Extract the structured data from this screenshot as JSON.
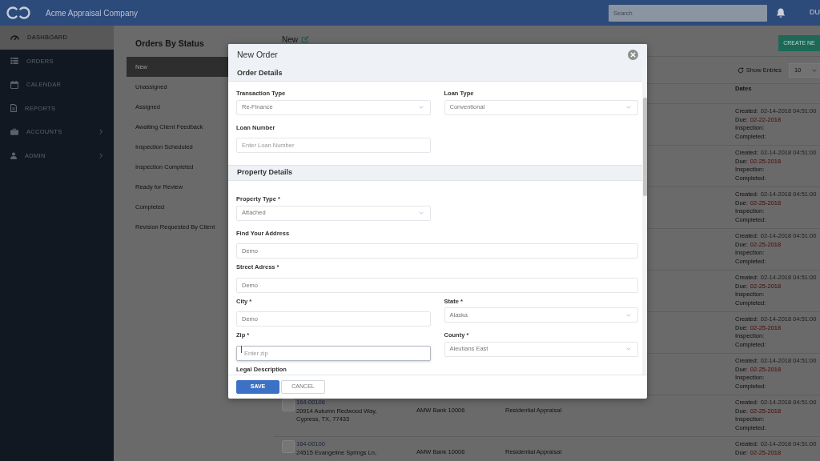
{
  "top_bar": {
    "title": "Acme Appraisal Company",
    "search": {
      "placeholder": "Search"
    },
    "user": "DU"
  },
  "sidebar": {
    "items": [
      {
        "label": "DASHBOARD",
        "selected": true,
        "expandable": false
      },
      {
        "label": "ORDERS",
        "selected": false,
        "expandable": false
      },
      {
        "label": "CALENDAR",
        "selected": false,
        "expandable": false
      },
      {
        "label": "REPORTS",
        "selected": false,
        "expandable": false
      },
      {
        "label": "ACCOUNTS",
        "selected": false,
        "expandable": true
      },
      {
        "label": "ADMIN",
        "selected": false,
        "expandable": true
      }
    ]
  },
  "orders_by_status": {
    "title": "Orders By Status",
    "items": [
      {
        "label": "New",
        "selected": true
      },
      {
        "label": "Unassigned",
        "selected": false
      },
      {
        "label": "Assigned",
        "selected": false
      },
      {
        "label": "Awaiting Client Feedback",
        "selected": false
      },
      {
        "label": "Inspection Scheduled",
        "selected": false
      },
      {
        "label": "Inspection Completed",
        "selected": false
      },
      {
        "label": "Ready for Review",
        "selected": false
      },
      {
        "label": "Completed",
        "selected": false
      },
      {
        "label": "Revision Requested By Client",
        "selected": false
      }
    ]
  },
  "orders": {
    "heading": "New",
    "create_button": "CREATE NE",
    "show_entries": {
      "label": "Show Entries",
      "value": "10"
    },
    "dates_header": "Dates",
    "rows": [
      {
        "dates": [
          {
            "kind": "created",
            "label": "Created:",
            "value": "02-14-2018 04:51:00"
          },
          {
            "kind": "due",
            "label": "Due:",
            "value": "02-22-2018"
          },
          {
            "label": "Inspection:"
          },
          {
            "label": "Completed:"
          }
        ]
      },
      {
        "dates": [
          {
            "kind": "created",
            "label": "Created:",
            "value": "02-14-2018 04:51:00"
          },
          {
            "kind": "due",
            "label": "Due:",
            "value": "02-25-2018"
          },
          {
            "label": "Inspection:"
          },
          {
            "label": "Completed:"
          }
        ]
      },
      {
        "dates": [
          {
            "kind": "created",
            "label": "Created:",
            "value": "02-14-2018 04:51:00"
          },
          {
            "kind": "due",
            "label": "Due:",
            "value": "02-25-2018"
          },
          {
            "label": "Inspection:"
          },
          {
            "label": "Completed:"
          }
        ]
      },
      {
        "dates": [
          {
            "kind": "created",
            "label": "Created:",
            "value": "02-14-2018 04:51:00"
          },
          {
            "kind": "due",
            "label": "Due:",
            "value": "02-25-2018"
          },
          {
            "label": "Inspection:"
          },
          {
            "label": "Completed:"
          }
        ]
      },
      {
        "dates": [
          {
            "kind": "created",
            "label": "Created:",
            "value": "02-14-2018 04:51:00"
          },
          {
            "kind": "due",
            "label": "Due:",
            "value": "02-25-2018"
          },
          {
            "label": "Inspection:"
          },
          {
            "label": "Completed:"
          }
        ]
      },
      {
        "dates": [
          {
            "kind": "created",
            "label": "Created:",
            "value": "02-14-2018 04:51:00"
          },
          {
            "kind": "due",
            "label": "Due:",
            "value": "02-25-2018"
          },
          {
            "label": "Inspection:"
          },
          {
            "label": "Completed:"
          }
        ]
      },
      {
        "dates": [
          {
            "kind": "created",
            "label": "Created:",
            "value": "02-14-2018 04:51:00"
          },
          {
            "kind": "due",
            "label": "Due:",
            "value": "02-25-2018"
          },
          {
            "label": "Inspection:"
          },
          {
            "label": "Completed:"
          }
        ]
      },
      {
        "checked": false,
        "order_id": "164-00106",
        "address": "20914 Autumn Redwood Way, Cypress, TX, 77433",
        "client": "AMW Bank 10006",
        "product": "Residential Appraisal",
        "dates": [
          {
            "kind": "created",
            "label": "Created:",
            "value": "02-14-2018 04:51:00"
          },
          {
            "kind": "due",
            "label": "Due:",
            "value": "02-25-2018"
          },
          {
            "label": "Inspection:"
          },
          {
            "label": "Completed:"
          }
        ]
      },
      {
        "checked": false,
        "order_id": "164-00100",
        "address": "24515 Evangeline Springs Ln,",
        "client": "AMW Bank 10006",
        "product": "Residential Appraisal",
        "dates": [
          {
            "kind": "created",
            "label": "Created:",
            "value": "02-14-2018 04:51:00"
          },
          {
            "kind": "due",
            "label": "Due:",
            "value": "02-25-2018"
          }
        ]
      }
    ]
  },
  "modal": {
    "title": "New Order",
    "sections": [
      {
        "title": "Order Details",
        "rows": [
          [
            {
              "label": "Transaction Type",
              "kind": "select",
              "value": "Re-Finance",
              "wide": false,
              "focused": false
            },
            {
              "label": "Loan Type",
              "kind": "select",
              "value": "Conventional",
              "wide": false,
              "focused": false
            }
          ],
          [
            {
              "label": "Loan Number",
              "kind": "input",
              "placeholder": "Enter Loan Number",
              "wide": false,
              "focused": false
            }
          ]
        ]
      },
      {
        "title": "Property Details",
        "rows": [
          [
            {
              "label": "Property Type *",
              "kind": "select",
              "value": "Attached",
              "wide": false,
              "focused": false
            }
          ],
          [
            {
              "label": "Find Your Address",
              "kind": "input",
              "value": "Demo",
              "wide": true,
              "focused": false
            }
          ],
          [
            {
              "label": "Street Adress *",
              "kind": "input",
              "value": "Demo",
              "wide": true,
              "focused": false
            }
          ],
          [
            {
              "label": "City *",
              "kind": "input",
              "value": "Demo",
              "wide": false,
              "focused": false
            },
            {
              "label": "State *",
              "kind": "select",
              "value": "Alaska",
              "wide": false,
              "focused": false
            }
          ],
          [
            {
              "label": "Zip *",
              "kind": "input",
              "placeholder": "Enter zip",
              "wide": false,
              "focused": true
            },
            {
              "label": "County *",
              "kind": "select",
              "value": "Aleutians East",
              "wide": false,
              "focused": false
            }
          ],
          [
            {
              "label": "Legal Description"
            }
          ]
        ]
      }
    ],
    "buttons": [
      {
        "label": "SAVE",
        "kind": "primary"
      },
      {
        "label": "CANCEL",
        "kind": "secondary"
      }
    ]
  }
}
